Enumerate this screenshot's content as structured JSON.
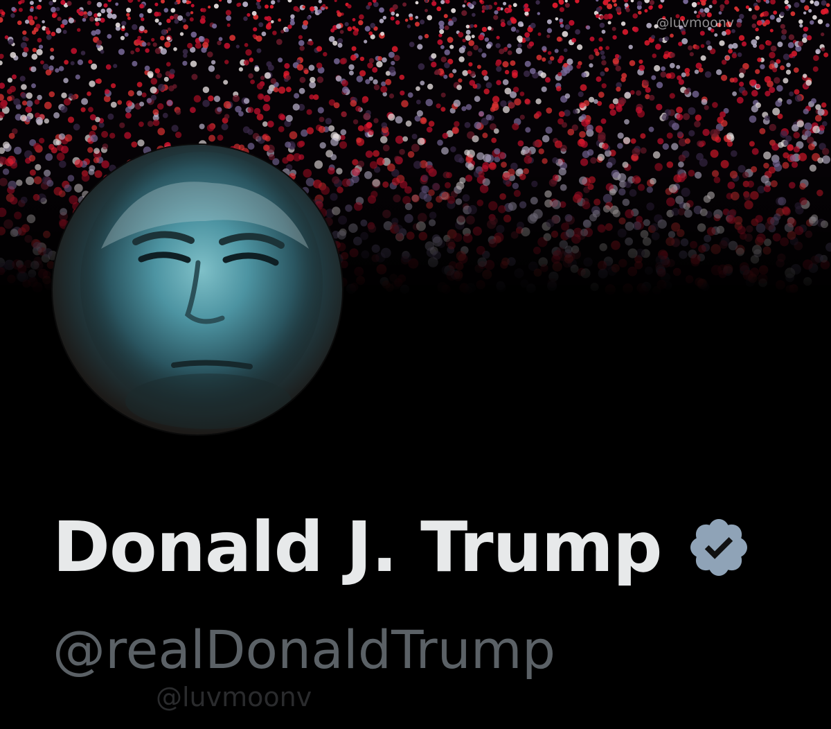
{
  "profile": {
    "display_name": "Donald J. Trump",
    "handle": "@realDonaldTrump",
    "verified": true
  },
  "watermarks": {
    "top": "@luvmoonv",
    "bottom": "@luvmoonv"
  },
  "icons": {
    "verified": "verified-badge-icon"
  },
  "colors": {
    "background": "#000000",
    "name": "#e7e9ea",
    "handle": "#5b6166",
    "verified_badge": "#8fa3b7",
    "crowd_red": "#c8102e",
    "crowd_white": "#e8e0e0"
  }
}
